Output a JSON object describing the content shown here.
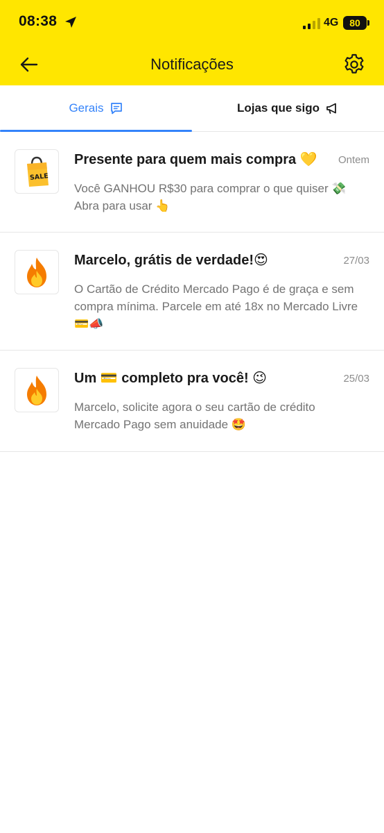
{
  "status_bar": {
    "time": "08:38",
    "network": "4G",
    "battery": "80"
  },
  "header": {
    "title": "Notificações"
  },
  "tabs": [
    {
      "label": "Gerais",
      "active": true,
      "icon": "chat-icon"
    },
    {
      "label": "Lojas que sigo",
      "active": false,
      "icon": "megaphone-icon"
    }
  ],
  "notifications": [
    {
      "thumb_icon": "sale-bag-icon",
      "title": "Presente para quem mais compra 💛",
      "date": "Ontem",
      "body": "Você GANHOU R$30 para comprar o que quiser 💸 Abra para usar 👆"
    },
    {
      "thumb_icon": "fire-icon",
      "title": "Marcelo, grátis de verdade!😍",
      "date": "27/03",
      "body": "O Cartão de Crédito Mercado Pago é de graça e sem compra mínima. Parcele em até 18x no Mercado Livre 💳📣"
    },
    {
      "thumb_icon": "fire-icon",
      "title": "Um 💳 completo pra você! 😉",
      "date": "25/03",
      "body": "Marcelo, solicite agora o seu cartão de crédito Mercado Pago sem anuidade 🤩"
    }
  ],
  "colors": {
    "header_bg": "#FFE600",
    "accent": "#3483FA",
    "secondary_text": "#737373"
  }
}
